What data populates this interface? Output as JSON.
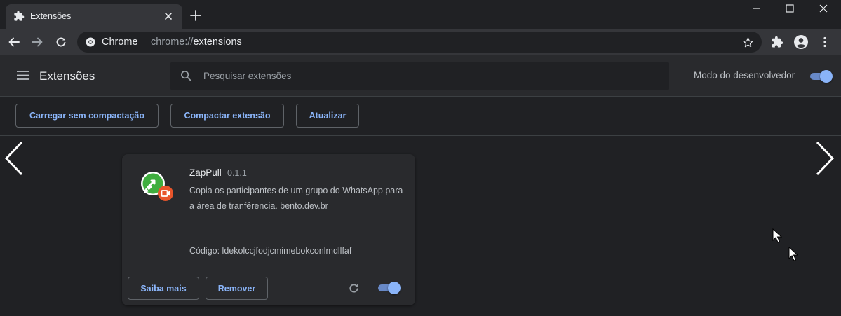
{
  "browser": {
    "tab": {
      "title": "Extensões",
      "favicon": "puzzle-icon"
    },
    "app_name": "Chrome",
    "url_scheme": "chrome://",
    "url_path": "extensions"
  },
  "header": {
    "title": "Extensões",
    "search_placeholder": "Pesquisar extensões",
    "developer_mode_label": "Modo do desenvolvedor",
    "developer_mode_on": true
  },
  "actions": {
    "load_unpacked": "Carregar sem compactação",
    "pack_extension": "Compactar extensão",
    "update": "Atualizar"
  },
  "extension": {
    "name": "ZapPull",
    "version": "0.1.1",
    "description": "Copia os participantes de um grupo do WhatsApp para a área de tranfêrencia. bento.dev.br",
    "code": "Código: ldekolccjfodjcmimebokconlmdllfaf",
    "details_label": "Saiba mais",
    "remove_label": "Remover",
    "enabled": true
  },
  "colors": {
    "accent": "#8ab4f8",
    "background": "#202124",
    "toolbar": "#35363a",
    "card": "#292a2d"
  }
}
